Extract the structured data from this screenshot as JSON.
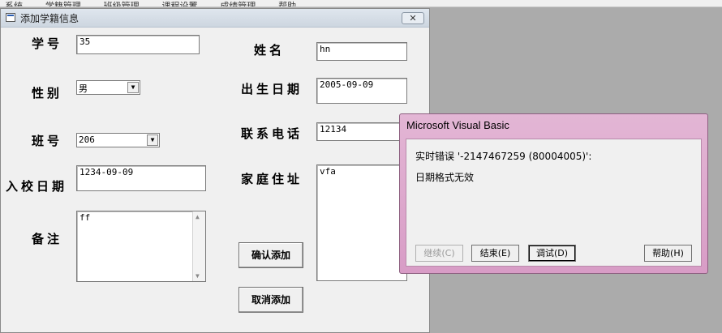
{
  "menubar": {
    "items": [
      "系统",
      "学籍管理",
      "班级管理",
      "课程设置",
      "成绩管理",
      "帮助"
    ]
  },
  "form": {
    "title": "添加学籍信息",
    "close_glyph": "✕",
    "labels": {
      "student_id": "学号",
      "name": "姓名",
      "gender": "性别",
      "birth_date": "出生日期",
      "class_id": "班号",
      "phone": "联系电话",
      "enroll_date": "入校日期",
      "address": "家庭住址",
      "notes": "备注"
    },
    "values": {
      "student_id": "35",
      "name": "hn",
      "gender": "男",
      "birth_date": "2005-09-09",
      "class_id": "206",
      "phone": "12134",
      "enroll_date": "1234-09-09",
      "address": "vfa",
      "notes": "ff"
    },
    "buttons": {
      "confirm_add": "确认添加",
      "cancel_add": "取消添加"
    }
  },
  "dialog": {
    "title": "Microsoft Visual Basic",
    "message_line1": "实时错误 '-2147467259 (80004005)':",
    "message_line2": "日期格式无效",
    "buttons": {
      "continue": "继续(C)",
      "end": "结束(E)",
      "debug": "调试(D)",
      "help": "帮助(H)"
    }
  }
}
